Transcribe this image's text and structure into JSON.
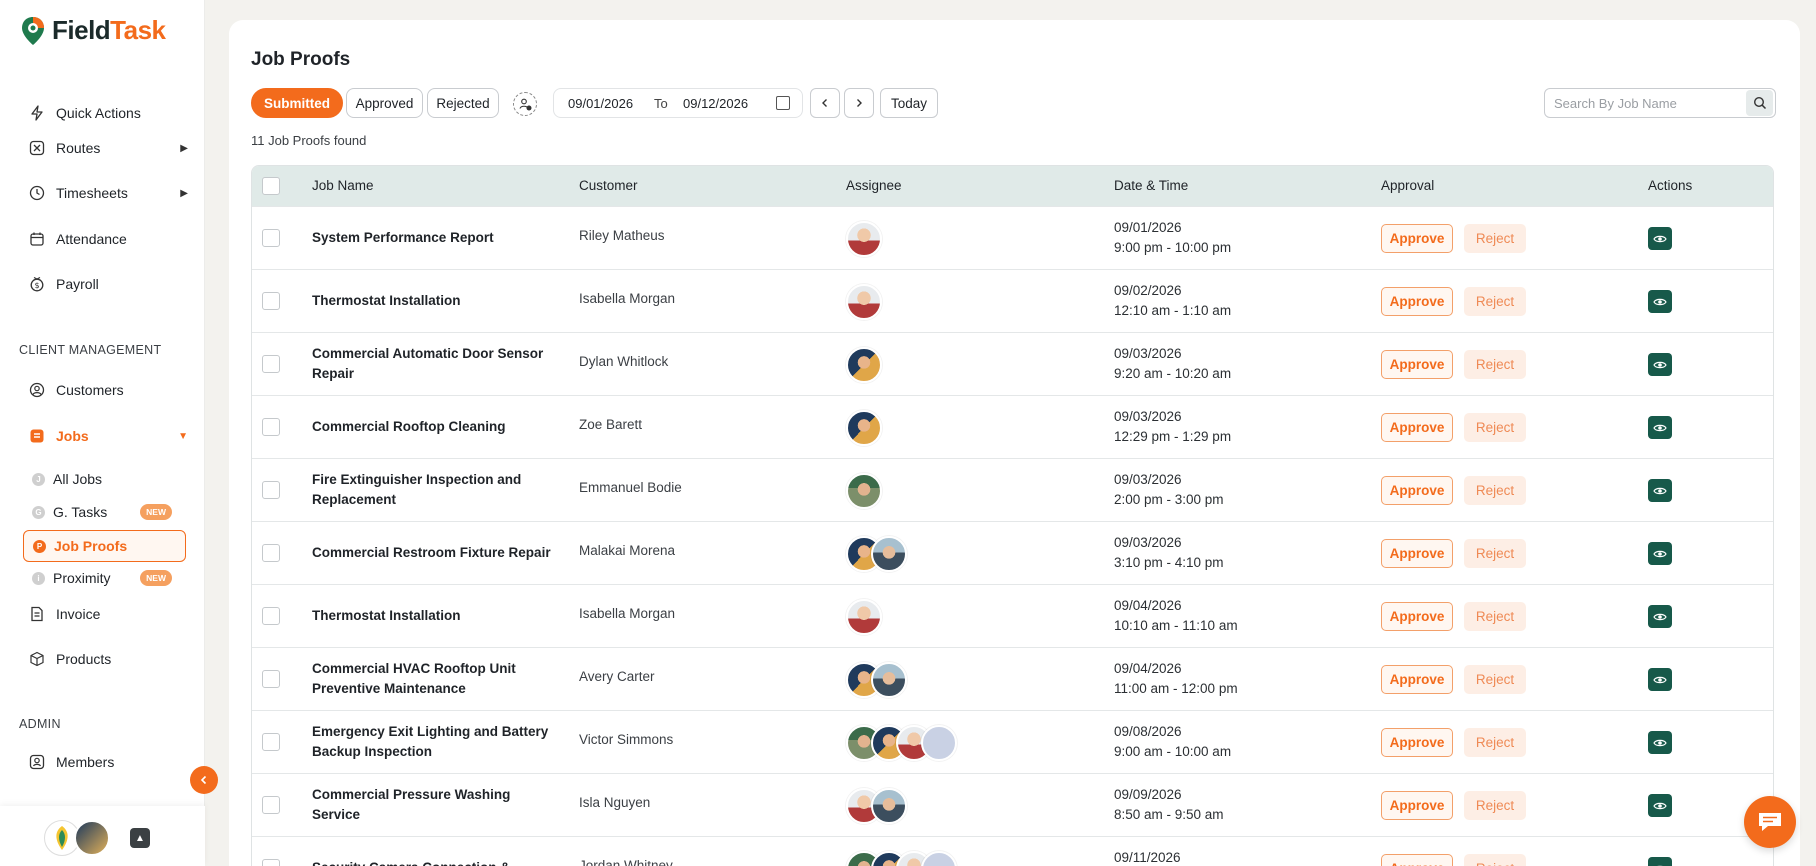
{
  "app": {
    "name_part1": "Field",
    "name_part2": "Task"
  },
  "sidebar": {
    "top_items": [
      {
        "label": "Quick Actions",
        "icon": "bolt-icon"
      },
      {
        "label": "Routes",
        "icon": "route-icon",
        "has_submenu": true
      },
      {
        "label": "Timesheets",
        "icon": "clock-icon",
        "has_submenu": true
      },
      {
        "label": "Attendance",
        "icon": "calendar-icon"
      },
      {
        "label": "Payroll",
        "icon": "payroll-icon"
      }
    ],
    "client_section_title": "CLIENT MANAGEMENT",
    "client_items": [
      {
        "label": "Customers",
        "icon": "user-circle-icon"
      },
      {
        "label": "Jobs",
        "icon": "jobs-icon",
        "expanded": true
      }
    ],
    "job_subitems": [
      {
        "label": "All Jobs",
        "letter": "J"
      },
      {
        "label": "G. Tasks",
        "letter": "G",
        "badge": "NEW"
      },
      {
        "label": "Job Proofs",
        "letter": "P",
        "active": true
      },
      {
        "label": "Proximity",
        "letter": "i",
        "badge": "NEW"
      }
    ],
    "other_items": [
      {
        "label": "Invoice",
        "icon": "invoice-icon"
      },
      {
        "label": "Products",
        "icon": "box-icon"
      }
    ],
    "admin_section_title": "ADMIN",
    "admin_items": [
      {
        "label": "Members",
        "icon": "user-card-icon"
      }
    ],
    "accent_color": "#f36b1c"
  },
  "page": {
    "title": "Job Proofs",
    "tabs": [
      "Submitted",
      "Approved",
      "Rejected"
    ],
    "active_tab": "Submitted",
    "date_from": "09/01/2026",
    "date_to_label": "To",
    "date_to": "09/12/2026",
    "today_label": "Today",
    "search_placeholder": "Search By Job Name",
    "found_text": "11 Job Proofs found"
  },
  "table": {
    "headers": {
      "job": "Job Name",
      "customer": "Customer",
      "assignee": "Assignee",
      "datetime": "Date & Time",
      "approval": "Approval",
      "actions": "Actions"
    },
    "approve_label": "Approve",
    "reject_label": "Reject",
    "rows": [
      {
        "job": "System Performance Report",
        "customer": "Riley Matheus",
        "date": "09/01/2026",
        "time": "9:00 pm - 10:00 pm",
        "avatars": [
          "a1"
        ]
      },
      {
        "job": "Thermostat Installation",
        "customer": "Isabella Morgan",
        "date": "09/02/2026",
        "time": "12:10 am - 1:10 am",
        "avatars": [
          "a1"
        ]
      },
      {
        "job": "Commercial Automatic Door Sensor Repair",
        "customer": "Dylan Whitlock",
        "date": "09/03/2026",
        "time": "9:20 am - 10:20 am",
        "avatars": [
          "a2"
        ]
      },
      {
        "job": "Commercial Rooftop Cleaning",
        "customer": "Zoe Barett",
        "date": "09/03/2026",
        "time": "12:29 pm - 1:29 pm",
        "avatars": [
          "a2"
        ]
      },
      {
        "job": "Fire Extinguisher Inspection and Replacement",
        "customer": "Emmanuel Bodie",
        "date": "09/03/2026",
        "time": "2:00 pm - 3:00 pm",
        "avatars": [
          "a3"
        ]
      },
      {
        "job": "Commercial Restroom Fixture Repair",
        "customer": "Malakai Morena",
        "date": "09/03/2026",
        "time": "3:10 pm - 4:10 pm",
        "avatars": [
          "a2",
          "a4"
        ]
      },
      {
        "job": "Thermostat Installation",
        "customer": "Isabella Morgan",
        "date": "09/04/2026",
        "time": "10:10 am - 11:10 am",
        "avatars": [
          "a1"
        ]
      },
      {
        "job": "Commercial HVAC Rooftop Unit Preventive Maintenance",
        "customer": "Avery Carter",
        "date": "09/04/2026",
        "time": "11:00 am - 12:00 pm",
        "avatars": [
          "a2",
          "a4"
        ]
      },
      {
        "job": "Emergency Exit Lighting and Battery Backup Inspection",
        "customer": "Victor Simmons",
        "date": "09/08/2026",
        "time": "9:00 am - 10:00 am",
        "avatars": [
          "a3",
          "a2",
          "a1",
          "a5"
        ]
      },
      {
        "job": "Commercial Pressure Washing Service",
        "customer": "Isla Nguyen",
        "date": "09/09/2026",
        "time": "8:50 am - 9:50 am",
        "avatars": [
          "a1",
          "a4"
        ]
      },
      {
        "job": "Security Camera Connection &",
        "customer": "Jordan Whitney",
        "date": "09/11/2026",
        "time": "",
        "avatars": [
          "a3",
          "a2",
          "a1",
          "a5"
        ]
      }
    ]
  }
}
